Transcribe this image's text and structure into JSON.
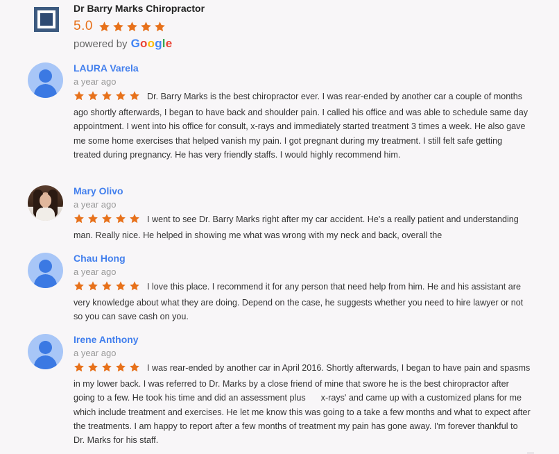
{
  "business": {
    "name": "Dr Barry Marks Chiropractor",
    "rating": "5.0",
    "stars": 5,
    "powered_by": "powered by",
    "google_letters": [
      "G",
      "o",
      "o",
      "g",
      "l",
      "e"
    ]
  },
  "colors": {
    "star": "#e7711b",
    "reviewer_name": "#427fed",
    "avatar_bg": "#a8c6f7",
    "avatar_fg": "#3b79e3",
    "logo": "#3d5a80"
  },
  "icons": {
    "logo": "square-logo-icon",
    "star": "star-icon",
    "avatar": "person-avatar-icon"
  },
  "reviews": [
    {
      "name": "LAURA Varela",
      "time": "a year ago",
      "stars": 5,
      "text": "Dr. Barry Marks is the best chiropractor ever. I was rear-ended by another car a couple of months ago shortly afterwards, I began to have back and shoulder pain. I called his office and was able to schedule same day appointment. I went into his office for consult, x-rays and immediately started treatment 3 times a week. He also gave me some home exercises that helped vanish my pain. I got pregnant during my treatment. I still felt safe getting treated during pregnancy. He has very friendly staffs. I would highly recommend him."
    },
    {
      "name": "Mary Olivo",
      "time": "a year ago",
      "stars": 5,
      "text": "I went to see Dr. Barry Marks right after my car accident. He's a really patient and understanding man. Really nice. He helped in showing me what was wrong with my neck and back, overall the"
    },
    {
      "name": "Chau Hong",
      "time": "a year ago",
      "stars": 5,
      "text": "I love this place. I recommend it for any person that need help from him. He and his assistant are very knowledge about what they are doing. Depend on the case, he suggests whether you need to hire lawyer or not so you can save cash on you."
    },
    {
      "name": "Irene Anthony",
      "time": "a year ago",
      "stars": 5,
      "text_a": "I was rear-ended by another car in April 2016. Shortly afterwards, I began to have pain and spasms in my lower back. I was referred to Dr. Marks by a close friend of mine that swore he is the best chiropractor after going to a few. He took his time and did an assessment plus",
      "text_b": "x-rays' and came up with a customized plans for me which include treatment and exercises. He let me know this was going to a take a few months and what to expect after the treatments. I am happy to report after a few months of treatment my pain has gone away. I'm forever thankful to Dr. Marks for his staff."
    }
  ]
}
